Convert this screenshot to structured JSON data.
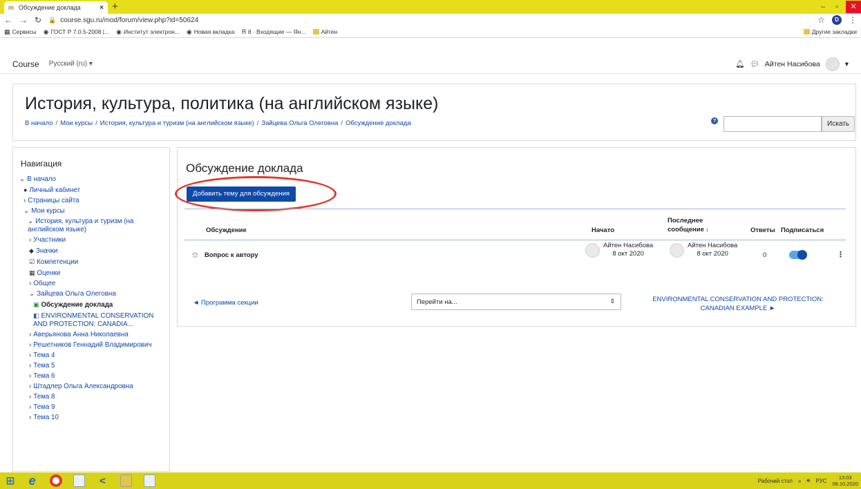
{
  "browser": {
    "tab_title": "Обсуждение доклада",
    "tab_close": "×",
    "new_tab": "+",
    "url": "course.sgu.ru/mod/forum/view.php?id=50624",
    "profile_letter": "D",
    "bookmarks": [
      {
        "label": "Сервисы",
        "icon": "apps-icon"
      },
      {
        "label": "ГОСТ Р 7.0.5-2008 |...",
        "icon": "globe-icon"
      },
      {
        "label": "Институт электрон...",
        "icon": "globe-icon"
      },
      {
        "label": "Новая вкладка",
        "icon": "globe-icon"
      },
      {
        "label": "8 · Входящие — Ян...",
        "icon": "yandex-icon"
      },
      {
        "label": "Айтен",
        "icon": "folder-icon"
      }
    ],
    "other_bookmarks": "Другие закладки"
  },
  "navbar": {
    "brand": "Course",
    "language": "Русский (ru)",
    "user_name": "Айтен Насибова"
  },
  "header": {
    "title": "История, культура, политика (на английском языке)",
    "breadcrumbs": [
      "В начало",
      "Мои курсы",
      "История, культура и туризм (на английском языке)",
      "Зайцева Ольга Олеговна",
      "Обсуждение доклада"
    ],
    "search_placeholder": "",
    "search_button": "Искать"
  },
  "navigation": {
    "heading": "Навигация",
    "items": [
      {
        "label": "В начало",
        "chev": "⌄"
      },
      {
        "label": "Личный кабинет",
        "icon": "dashboard-icon"
      },
      {
        "label": "Страницы сайта",
        "chev": "›"
      },
      {
        "label": "Мои курсы",
        "chev": "⌄"
      },
      {
        "label": "История, культура и туризм (на английском языке)",
        "chev": "⌄"
      },
      {
        "label": "Участники",
        "chev": "›"
      },
      {
        "label": "Значки",
        "icon": "badge-icon"
      },
      {
        "label": "Компетенции",
        "icon": "competency-icon"
      },
      {
        "label": "Оценки",
        "icon": "grades-icon"
      },
      {
        "label": "Общее",
        "chev": "›"
      },
      {
        "label": "Зайцева Ольга Олеговна",
        "chev": "⌄"
      },
      {
        "label": "Обсуждение доклада",
        "icon": "forum-icon"
      },
      {
        "label": "ENVIRONMENTAL CONSERVATION AND PROTECTION: CANADIA...",
        "icon": "resource-icon"
      },
      {
        "label": "Аверьянова Анна Николаевна",
        "chev": "›"
      },
      {
        "label": "Решетников Геннадий Владимирович",
        "chev": "›"
      },
      {
        "label": "Тема 4",
        "chev": "›"
      },
      {
        "label": "Тема 5",
        "chev": "›"
      },
      {
        "label": "Тема 6",
        "chev": "›"
      },
      {
        "label": "Штадлер Ольга Александровна",
        "chev": "›"
      },
      {
        "label": "Тема 8",
        "chev": "›"
      },
      {
        "label": "Тема 9",
        "chev": "›"
      },
      {
        "label": "Тема 10",
        "chev": "›"
      }
    ]
  },
  "forum": {
    "title": "Обсуждение доклада",
    "add_button": "Добавить тему для обсуждения",
    "columns": {
      "discussion": "Обсуждение",
      "started": "Начато",
      "last_post_line1": "Последнее",
      "last_post_line2": "сообщение ↓",
      "replies": "Ответы",
      "subscribe": "Подписаться"
    },
    "rows": [
      {
        "subject": "Вопрос к автору",
        "started_by": "Айтен Насибова",
        "started_date": "8 окт 2020",
        "last_by": "Айтен Насибова",
        "last_date": "8 окт 2020",
        "replies": "0",
        "subscribed": true
      }
    ],
    "prev_section": "◄ Программа секции",
    "jump_placeholder": "Перейти на...",
    "next_line1": "ENVIRONMENTAL CONSERVATION AND PROTECTION:",
    "next_line2": "CANADIAN EXAMPLE ►"
  },
  "taskbar": {
    "desktop_label": "Рабочий стол",
    "lang": "РУС",
    "time": "13:03",
    "date": "08.10.2020"
  },
  "colors": {
    "titlebar": "#e7de1a",
    "link": "#0f47ad",
    "primary_button": "#0f4aa8",
    "annotation_oval": "#e0392b"
  }
}
